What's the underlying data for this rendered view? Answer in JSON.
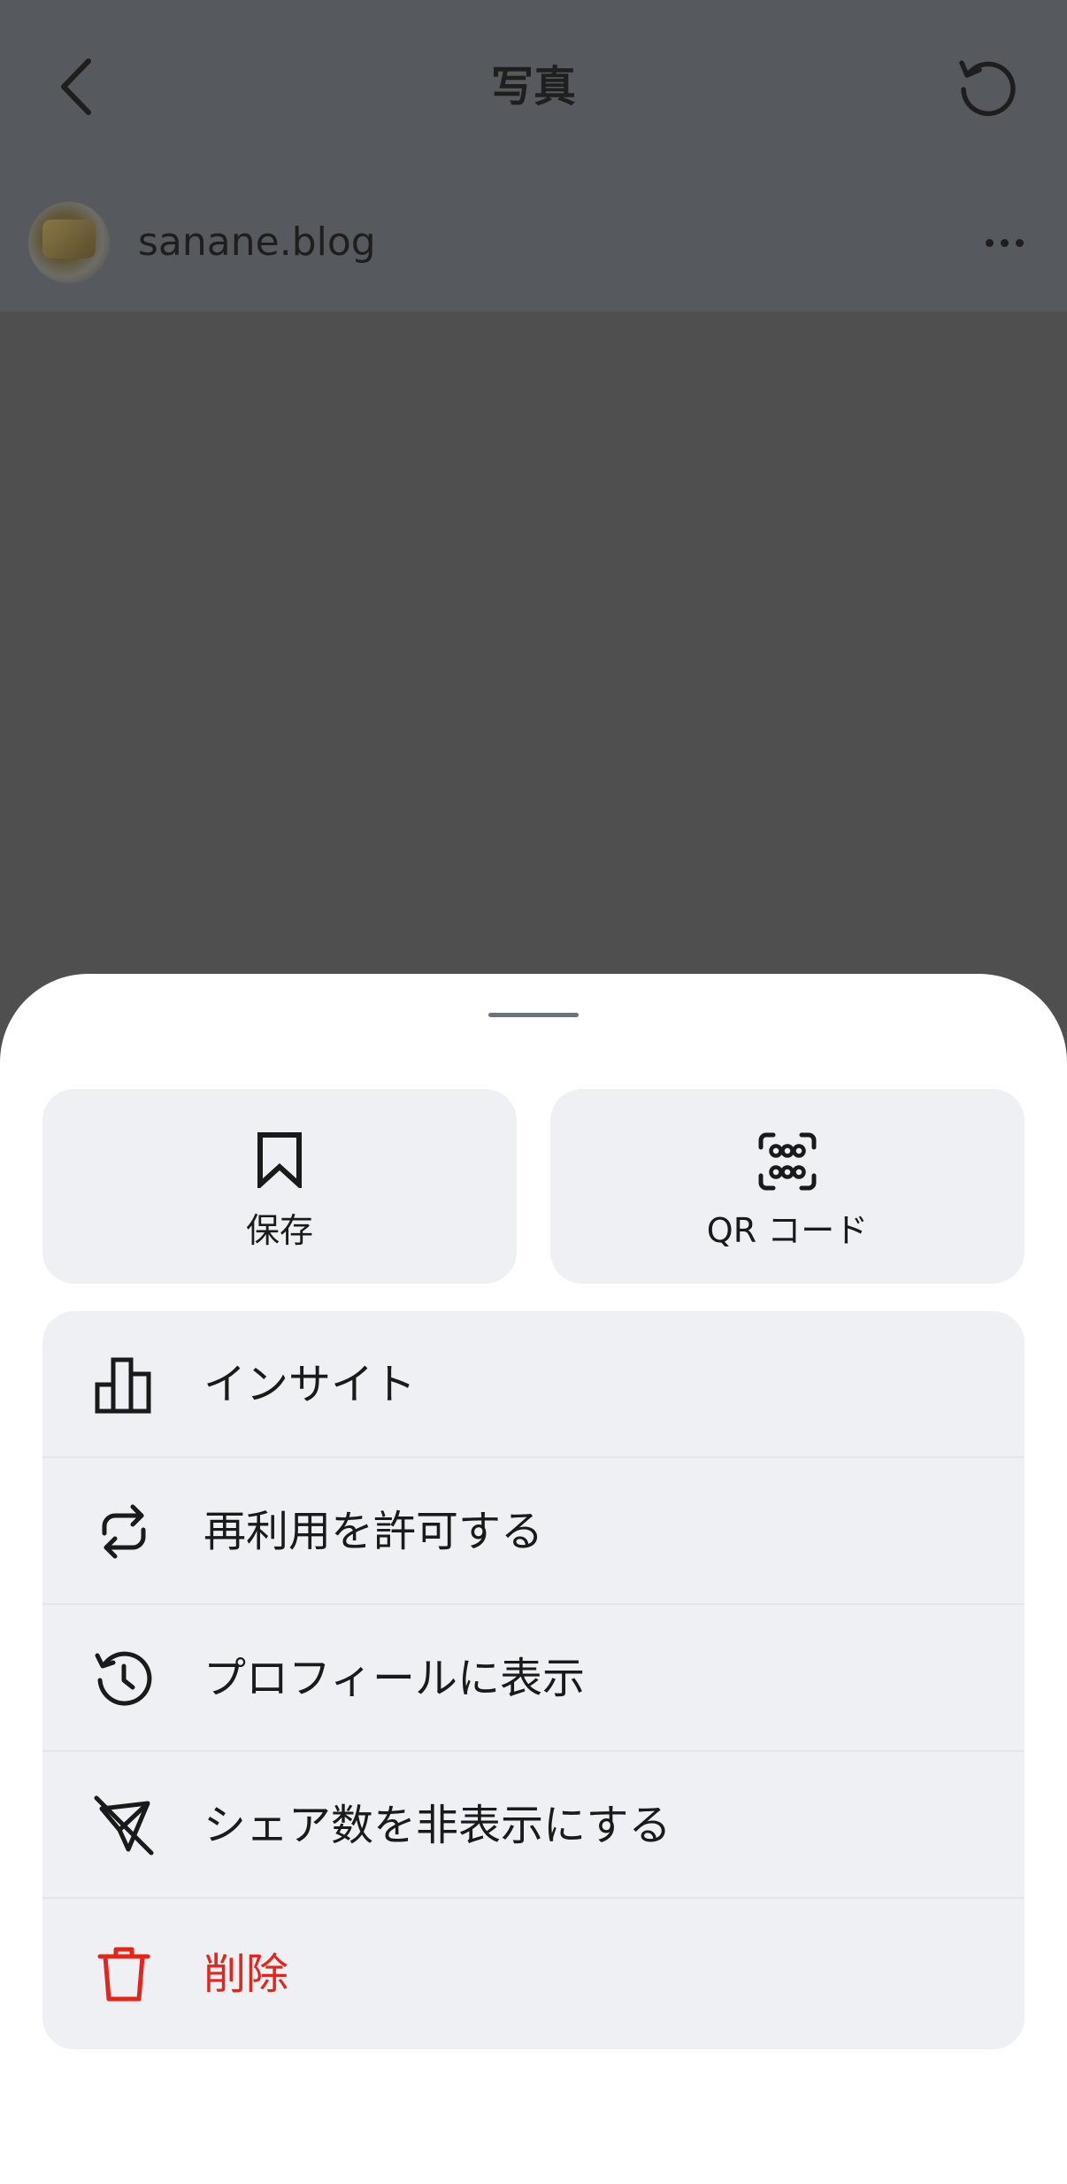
{
  "nav": {
    "title": "写真",
    "back_icon": "chevron-left-icon",
    "refresh_icon": "refresh-icon"
  },
  "author": {
    "name": "sanane.blog",
    "more_icon": "more-horizontal-icon"
  },
  "sheet": {
    "tiles": [
      {
        "label": "保存",
        "icon": "bookmark-icon"
      },
      {
        "label": "QR コード",
        "icon": "qr-code-icon"
      }
    ],
    "menu": [
      {
        "label": "インサイト",
        "icon": "bar-chart-icon"
      },
      {
        "label": "再利用を許可する",
        "icon": "repost-icon"
      },
      {
        "label": "プロフィールに表示",
        "icon": "history-icon"
      },
      {
        "label": "シェア数を非表示にする",
        "icon": "share-hidden-icon"
      },
      {
        "label": "削除",
        "icon": "trash-icon"
      }
    ]
  },
  "colors": {
    "danger": "#e0261d",
    "tile_bg": "#eff0f4",
    "overlay": "#4f4f4f"
  }
}
